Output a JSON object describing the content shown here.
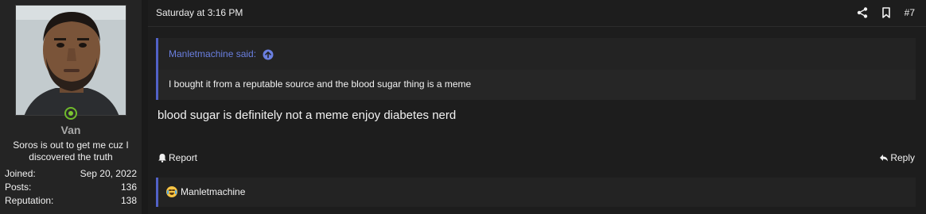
{
  "user": {
    "name": "Van",
    "title": "Soros is out to get me cuz I discovered the truth",
    "stats": [
      {
        "label": "Joined:",
        "value": "Sep 20, 2022"
      },
      {
        "label": "Posts:",
        "value": "136"
      },
      {
        "label": "Reputation:",
        "value": "138"
      }
    ],
    "online_color": "#7cc532"
  },
  "post": {
    "date": "Saturday at 3:16 PM",
    "number": "#7",
    "quote": {
      "author": "Manletmachine said:",
      "text": "I bought it from a reputable source and the blood sugar thing is a meme"
    },
    "body": "blood sugar is definitely not a meme enjoy diabetes nerd",
    "actions": {
      "report": "Report",
      "reply": "Reply"
    },
    "reactions": {
      "users": "Manletmachine",
      "emoji": "crying-laughing"
    }
  },
  "colors": {
    "accent": "#5262c7",
    "link": "#6a7fe0"
  },
  "icons": [
    "share-icon",
    "bookmark-icon",
    "arrow-up-circle-icon",
    "bell-icon",
    "reply-arrow-icon"
  ]
}
